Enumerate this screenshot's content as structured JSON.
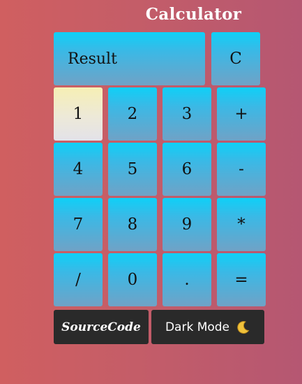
{
  "app": {
    "title": "Calculator"
  },
  "display": {
    "value": "Result"
  },
  "keys": {
    "clear": "C",
    "one": "1",
    "two": "2",
    "three": "3",
    "plus": "+",
    "four": "4",
    "five": "5",
    "six": "6",
    "minus": "-",
    "seven": "7",
    "eight": "8",
    "nine": "9",
    "multiply": "*",
    "divide": "/",
    "zero": "0",
    "dot": ".",
    "equals": "="
  },
  "footer": {
    "source_label": "SourceCode",
    "dark_mode_label": "Dark Mode",
    "dark_mode_icon": "crescent-moon-icon"
  },
  "colors": {
    "background_start": "#d05f60",
    "background_end": "#b55772",
    "key_top": "#0fd0f7",
    "key_bottom": "#70a2c6",
    "key_pressed": "#f6efb4",
    "footer_button": "#2a2a2a",
    "title_text": "#ffffff"
  }
}
